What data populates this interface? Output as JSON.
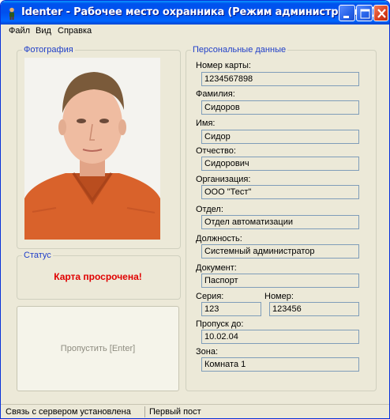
{
  "window": {
    "title": "Identer - Рабочее место охранника (Режим администратора)",
    "icon": "app-figure-icon"
  },
  "menu": [
    "Файл",
    "Вид",
    "Справка"
  ],
  "photo_group": {
    "title": "Фотография"
  },
  "status_group": {
    "title": "Статус",
    "message": "Карта просрочена!",
    "message_color": "#e00000"
  },
  "skip_button": {
    "label": "Пропустить [Enter]"
  },
  "personal": {
    "title": "Персональные данные",
    "card_number": {
      "label": "Номер карты:",
      "value": "1234567898"
    },
    "surname": {
      "label": "Фамилия:",
      "value": "Сидоров"
    },
    "name": {
      "label": "Имя:",
      "value": "Сидор"
    },
    "patronymic": {
      "label": "Отчество:",
      "value": "Сидорович"
    },
    "organization": {
      "label": "Организация:",
      "value": "ООО \"Тест\""
    },
    "department": {
      "label": "Отдел:",
      "value": "Отдел автоматизации"
    },
    "position": {
      "label": "Должность:",
      "value": "Системный администратор"
    },
    "document": {
      "label": "Документ:",
      "value": "Паспорт"
    },
    "series": {
      "label": "Серия:",
      "value": "123"
    },
    "doc_number": {
      "label": "Номер:",
      "value": "123456"
    },
    "pass_until": {
      "label": "Пропуск до:",
      "value": "10.02.04"
    },
    "zone": {
      "label": "Зона:",
      "value": "Комната 1"
    }
  },
  "statusbar": {
    "connection": "Связь с сервером установлена",
    "post": "Первый пост"
  },
  "colors": {
    "title_bar": "#0054e3",
    "group_title": "#1f3ec8",
    "alert": "#e00000",
    "window_bg": "#ece9d8"
  }
}
